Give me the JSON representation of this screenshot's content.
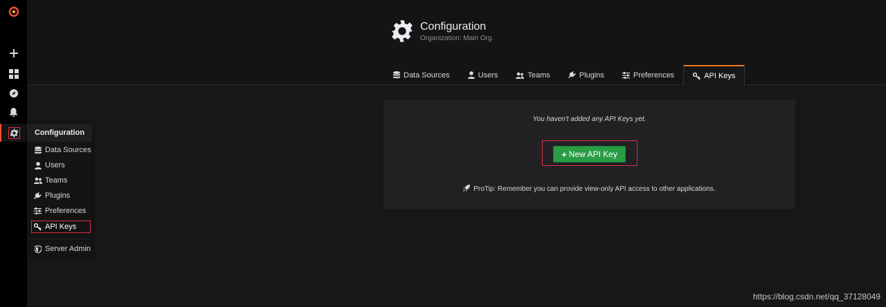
{
  "sidebar": {
    "icons": [
      "grafana-logo-icon",
      "plus-icon",
      "dashboards-icon",
      "explore-icon",
      "alert-bell-icon",
      "gear-icon"
    ]
  },
  "header": {
    "title": "Configuration",
    "subtitle": "Organization: Main Org."
  },
  "tabs": [
    {
      "label": "Data Sources",
      "icon": "database-icon"
    },
    {
      "label": "Users",
      "icon": "user-icon"
    },
    {
      "label": "Teams",
      "icon": "users-icon"
    },
    {
      "label": "Plugins",
      "icon": "plug-icon"
    },
    {
      "label": "Preferences",
      "icon": "sliders-icon"
    },
    {
      "label": "API Keys",
      "icon": "key-icon",
      "active": true
    }
  ],
  "menu": {
    "title": "Configuration",
    "items": [
      {
        "label": "Data Sources",
        "icon": "database-icon"
      },
      {
        "label": "Users",
        "icon": "user-icon"
      },
      {
        "label": "Teams",
        "icon": "users-icon"
      },
      {
        "label": "Plugins",
        "icon": "plug-icon"
      },
      {
        "label": "Preferences",
        "icon": "sliders-icon"
      },
      {
        "label": "API Keys",
        "icon": "key-icon"
      },
      {
        "label": "Server Admin",
        "icon": "shield-icon"
      }
    ]
  },
  "panel": {
    "empty_message": "You haven't added any API Keys yet.",
    "new_button": "New API Key",
    "protip": "ProTip: Remember you can provide view-only API access to other applications."
  },
  "watermark": "https://blog.csdn.net/qq_37128049",
  "colors": {
    "accent": "#eb7b18",
    "primary_button": "#299c46",
    "highlight_outline": "#e02f44",
    "background": "#161719"
  }
}
